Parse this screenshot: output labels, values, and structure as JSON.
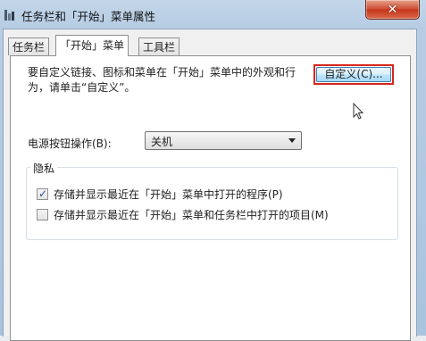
{
  "window": {
    "title": "任务栏和「开始」菜单属性",
    "close_label": "✕"
  },
  "tabs": [
    {
      "label": "任务栏",
      "active": false
    },
    {
      "label": "「开始」菜单",
      "active": true
    },
    {
      "label": "工具栏",
      "active": false
    }
  ],
  "start_menu": {
    "description": "要自定义链接、图标和菜单在「开始」菜单中的外观和行为，请单击“自定义”。",
    "customize_button": "自定义(C)...",
    "power_button_label": "电源按钮操作(B):",
    "power_button_value": "关机"
  },
  "privacy": {
    "title": "隐私",
    "items": [
      {
        "label": "存储并显示最近在「开始」菜单中打开的程序(P)",
        "checked": true
      },
      {
        "label": "存储并显示最近在「开始」菜单和任务栏中打开的项目(M)",
        "checked": false
      }
    ]
  },
  "colors": {
    "highlight_border": "#d8261d",
    "close_button": "#c43519"
  }
}
